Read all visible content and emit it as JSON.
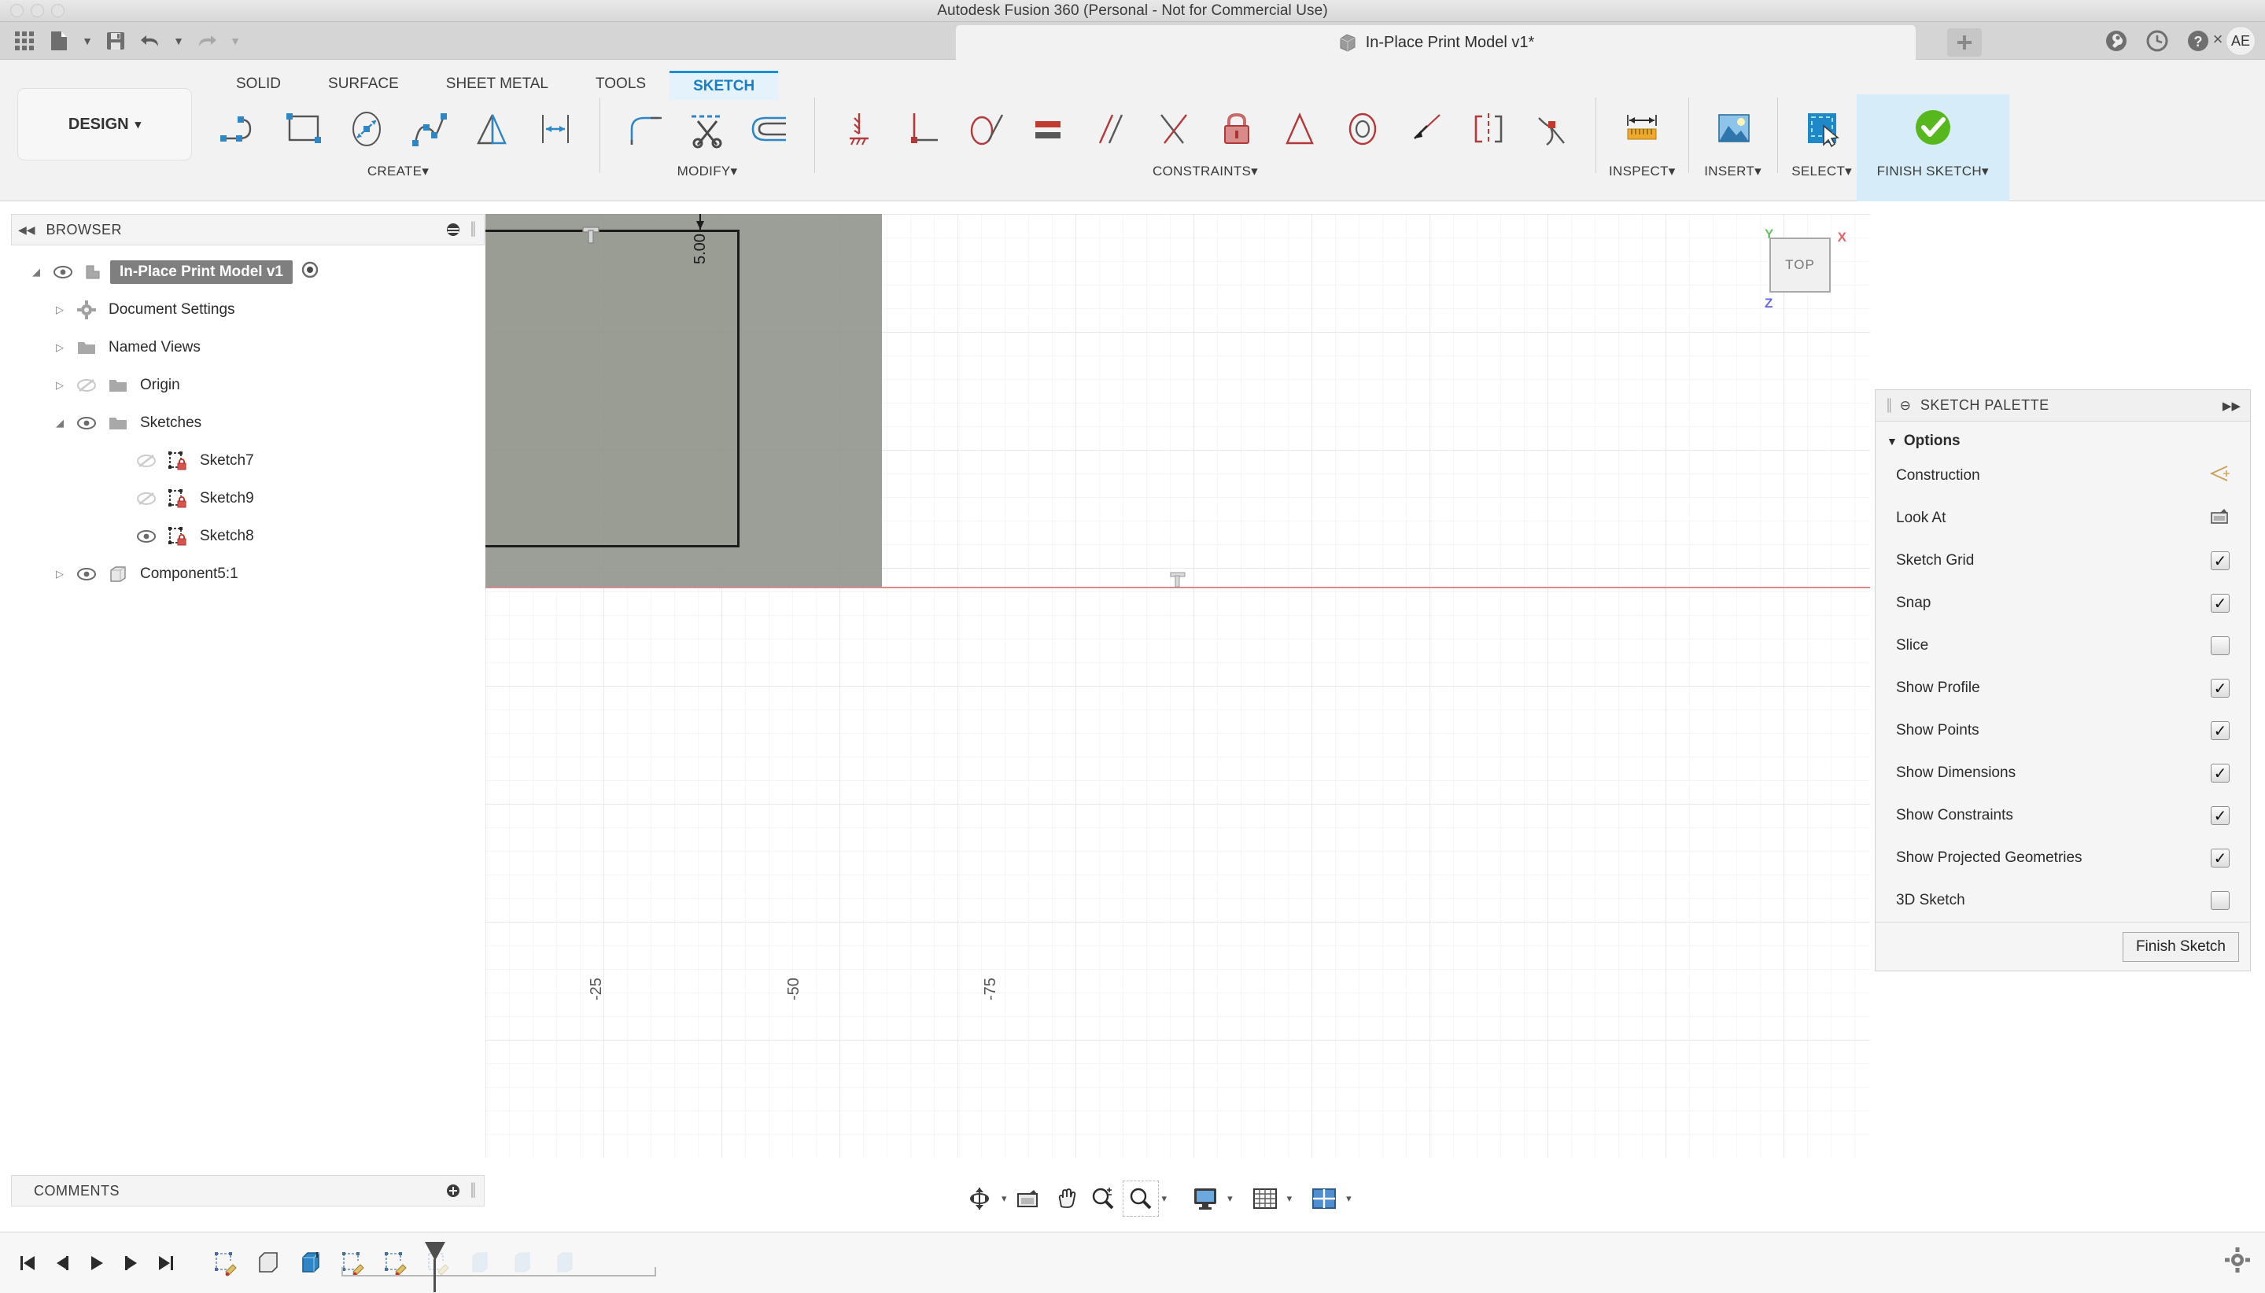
{
  "window": {
    "title": "Autodesk Fusion 360 (Personal - Not for Commercial Use)"
  },
  "tab": {
    "doc_title": "In-Place Print Model v1*",
    "close_label": "×",
    "plus_label": "+",
    "avatar_initials": "AE"
  },
  "right_tools": [
    {
      "name": "wrench-icon",
      "glyph": "⚒"
    },
    {
      "name": "clock-icon",
      "glyph": "◴"
    },
    {
      "name": "help-icon",
      "glyph": "?"
    }
  ],
  "quick_access": [
    {
      "name": "grid-apps-icon"
    },
    {
      "name": "new-document-icon"
    },
    {
      "name": "new-document-dropdown"
    },
    {
      "name": "save-icon"
    },
    {
      "name": "undo-icon"
    },
    {
      "name": "undo-dropdown"
    },
    {
      "name": "redo-icon"
    },
    {
      "name": "redo-dropdown"
    }
  ],
  "workspace": {
    "design_label": "DESIGN",
    "design_caret": "▾"
  },
  "tabs": [
    {
      "label": "SOLID",
      "active": false
    },
    {
      "label": "SURFACE",
      "active": false
    },
    {
      "label": "SHEET METAL",
      "active": false
    },
    {
      "label": "TOOLS",
      "active": false
    },
    {
      "label": "SKETCH",
      "active": true
    }
  ],
  "ribbon_panels": [
    {
      "label": "CREATE",
      "caret": "▾",
      "items": [
        {
          "name": "line-tool-icon"
        },
        {
          "name": "rectangle-tool-icon"
        },
        {
          "name": "circle-tool-icon"
        },
        {
          "name": "spline-tool-icon"
        },
        {
          "name": "mirror-tool-icon"
        },
        {
          "name": "dimension-tool-icon"
        }
      ]
    },
    {
      "label": "MODIFY",
      "caret": "▾",
      "items": [
        {
          "name": "fillet-tool-icon"
        },
        {
          "name": "trim-tool-icon"
        },
        {
          "name": "offset-tool-icon"
        }
      ]
    },
    {
      "label": "CONSTRAINTS",
      "caret": "▾",
      "items": [
        {
          "name": "coincident-constraint-icon"
        },
        {
          "name": "collinear-constraint-icon"
        },
        {
          "name": "tangent-constraint-icon"
        },
        {
          "name": "equal-constraint-icon"
        },
        {
          "name": "parallel-constraint-icon"
        },
        {
          "name": "perpendicular-constraint-icon"
        },
        {
          "name": "fix-unfix-constraint-icon"
        },
        {
          "name": "midpoint-constraint-icon"
        },
        {
          "name": "concentric-constraint-icon"
        },
        {
          "name": "horizontal-vertical-constraint-icon"
        },
        {
          "name": "symmetry-constraint-icon"
        },
        {
          "name": "curvature-constraint-icon"
        }
      ]
    },
    {
      "label": "INSPECT",
      "caret": "▾",
      "items": [
        {
          "name": "measure-icon"
        }
      ]
    },
    {
      "label": "INSERT",
      "caret": "▾",
      "items": [
        {
          "name": "insert-image-icon"
        }
      ]
    },
    {
      "label": "SELECT",
      "caret": "▾",
      "items": [
        {
          "name": "select-cursor-icon"
        }
      ]
    },
    {
      "label": "FINISH SKETCH",
      "caret": "▾",
      "items": [
        {
          "name": "finish-sketch-check-icon"
        }
      ],
      "highlight": true
    }
  ],
  "browser": {
    "header": "BROWSER",
    "collapse_icon": "◀◀",
    "menu_icon": "☰",
    "items": [
      {
        "label": "In-Place Print Model v1",
        "indent": 0,
        "arrow": "◢",
        "eye": true,
        "icon": "component-icon",
        "selected": true,
        "radio": true
      },
      {
        "label": "Document Settings",
        "indent": 1,
        "arrow": "▷",
        "eye": false,
        "icon": "gear-icon"
      },
      {
        "label": "Named Views",
        "indent": 1,
        "arrow": "▷",
        "eye": false,
        "icon": "folder-icon"
      },
      {
        "label": "Origin",
        "indent": 1,
        "arrow": "▷",
        "eye": "off",
        "icon": "folder-icon"
      },
      {
        "label": "Sketches",
        "indent": 1,
        "arrow": "◢",
        "eye": true,
        "icon": "folder-icon"
      },
      {
        "label": "Sketch7",
        "indent": 2,
        "arrow": "",
        "eye": "off",
        "icon": "sketch-locked-icon"
      },
      {
        "label": "Sketch9",
        "indent": 2,
        "arrow": "",
        "eye": "off",
        "icon": "sketch-locked-icon"
      },
      {
        "label": "Sketch8",
        "indent": 2,
        "arrow": "",
        "eye": true,
        "icon": "sketch-locked-icon"
      },
      {
        "label": "Component5:1",
        "indent": 1,
        "arrow": "▷",
        "eye": true,
        "icon": "body-icon"
      }
    ]
  },
  "canvas": {
    "viewcube_face": "TOP",
    "axis_x_label": "X",
    "axis_y_label": "Y",
    "axis_z_label": "Z",
    "dimension_value": "5.00",
    "ruler_labels": [
      "-25",
      "-50",
      "-75"
    ],
    "colors": {
      "plane_fill": "#8e9289",
      "profile_stroke": "#1c1c1c",
      "x_axis": "#d98a8f",
      "y_axis": "#7fca7f"
    }
  },
  "palette": {
    "header": "SKETCH PALETTE",
    "minimize_icon": "⊖",
    "expand_icon": "▶▶",
    "section_label": "Options",
    "section_caret": "▼",
    "options": [
      {
        "label": "Construction",
        "control": "icon",
        "icon": "construction-line-icon"
      },
      {
        "label": "Look At",
        "control": "icon",
        "icon": "look-at-camera-icon"
      },
      {
        "label": "Sketch Grid",
        "control": "checkbox",
        "checked": true
      },
      {
        "label": "Snap",
        "control": "checkbox",
        "checked": true
      },
      {
        "label": "Slice",
        "control": "checkbox",
        "checked": false
      },
      {
        "label": "Show Profile",
        "control": "checkbox",
        "checked": true
      },
      {
        "label": "Show Points",
        "control": "checkbox",
        "checked": true
      },
      {
        "label": "Show Dimensions",
        "control": "checkbox",
        "checked": true
      },
      {
        "label": "Show Constraints",
        "control": "checkbox",
        "checked": true
      },
      {
        "label": "Show Projected Geometries",
        "control": "checkbox",
        "checked": true
      },
      {
        "label": "3D Sketch",
        "control": "checkbox",
        "checked": false
      }
    ],
    "finish_button": "Finish Sketch"
  },
  "comments": {
    "header": "COMMENTS",
    "add_icon": "⊕"
  },
  "navbar": [
    {
      "name": "orbit-icon",
      "caret": "▾"
    },
    {
      "name": "look-at-icon",
      "caret": ""
    },
    {
      "name": "pan-icon",
      "caret": ""
    },
    {
      "name": "zoom-icon",
      "caret": ""
    },
    {
      "name": "fit-icon",
      "caret": "▾"
    },
    {
      "name": "display-settings-icon",
      "caret": "▾"
    },
    {
      "name": "grid-settings-icon",
      "caret": "▾"
    },
    {
      "name": "viewports-icon",
      "caret": "▾"
    }
  ],
  "timeline": {
    "playback": [
      {
        "name": "timeline-go-start-icon",
        "glyph": "⏮"
      },
      {
        "name": "timeline-step-back-icon",
        "glyph": "◀"
      },
      {
        "name": "timeline-play-icon",
        "glyph": "▶"
      },
      {
        "name": "timeline-step-forward-icon",
        "glyph": "▶"
      },
      {
        "name": "timeline-go-end-icon",
        "glyph": "⏭"
      }
    ],
    "features": [
      {
        "name": "timeline-sketch-feature",
        "kind": "sketch"
      },
      {
        "name": "timeline-body-feature",
        "kind": "body"
      },
      {
        "name": "timeline-extrude-feature",
        "kind": "extrude"
      },
      {
        "name": "timeline-sketch-feature",
        "kind": "sketch"
      },
      {
        "name": "timeline-sketch-feature",
        "kind": "sketch"
      },
      {
        "name": "timeline-sketch-feature",
        "kind": "sketch-dim"
      },
      {
        "name": "timeline-ghost-feature",
        "kind": "ghost"
      },
      {
        "name": "timeline-ghost-feature",
        "kind": "ghost"
      },
      {
        "name": "timeline-ghost-feature",
        "kind": "ghost"
      }
    ],
    "settings_icon": "gear-icon"
  }
}
